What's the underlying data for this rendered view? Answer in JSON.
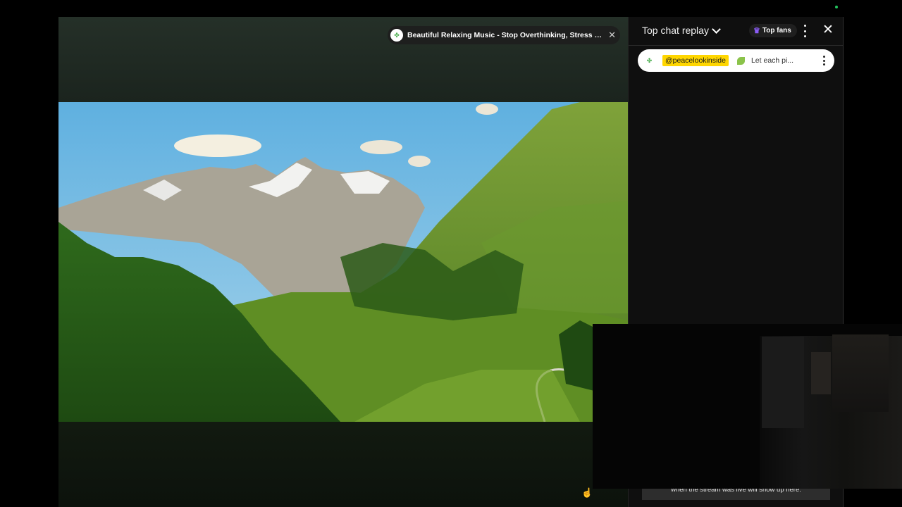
{
  "video": {
    "title": "Beautiful Relaxing Music - Stop Overthinking, Stress Relief Mus...",
    "channel_icon": "clover-icon",
    "close_icon": "close-icon"
  },
  "chat": {
    "header_title": "Top chat replay",
    "top_fans_label": "Top fans",
    "pinned": {
      "author": "@peacelookinside",
      "message": "Let each pi..."
    },
    "notice": "when the stream was live will show up here."
  },
  "colors": {
    "accent_yellow": "#ffd600",
    "crown_purple": "#8b5cf6",
    "status_green": "#22c55e"
  }
}
